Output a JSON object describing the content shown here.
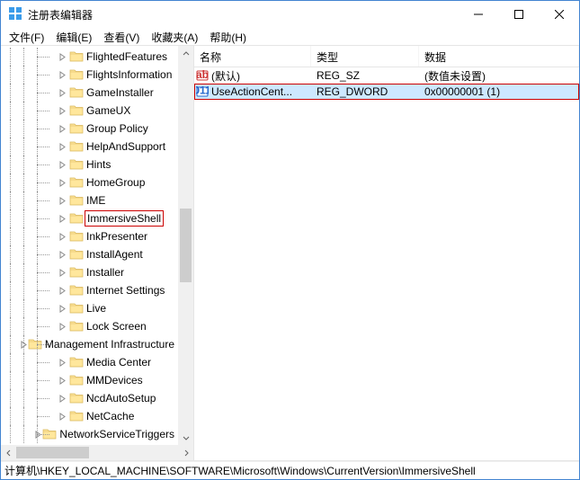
{
  "window": {
    "title": "注册表编辑器"
  },
  "menus": {
    "file": "文件(F)",
    "edit": "编辑(E)",
    "view": "查看(V)",
    "fav": "收藏夹(A)",
    "help": "帮助(H)"
  },
  "tree": {
    "items": [
      {
        "label": "FlightedFeatures",
        "selectedFlag": false
      },
      {
        "label": "FlightsInformation",
        "selectedFlag": false
      },
      {
        "label": "GameInstaller",
        "selectedFlag": false
      },
      {
        "label": "GameUX",
        "selectedFlag": false
      },
      {
        "label": "Group Policy",
        "selectedFlag": false
      },
      {
        "label": "HelpAndSupport",
        "selectedFlag": false
      },
      {
        "label": "Hints",
        "selectedFlag": false
      },
      {
        "label": "HomeGroup",
        "selectedFlag": false
      },
      {
        "label": "IME",
        "selectedFlag": false
      },
      {
        "label": "ImmersiveShell",
        "selectedFlag": true
      },
      {
        "label": "InkPresenter",
        "selectedFlag": false
      },
      {
        "label": "InstallAgent",
        "selectedFlag": false
      },
      {
        "label": "Installer",
        "selectedFlag": false
      },
      {
        "label": "Internet Settings",
        "selectedFlag": false
      },
      {
        "label": "Live",
        "selectedFlag": false
      },
      {
        "label": "Lock Screen",
        "selectedFlag": false
      },
      {
        "label": "Management Infrastructure",
        "selectedFlag": false
      },
      {
        "label": "Media Center",
        "selectedFlag": false
      },
      {
        "label": "MMDevices",
        "selectedFlag": false
      },
      {
        "label": "NcdAutoSetup",
        "selectedFlag": false
      },
      {
        "label": "NetCache",
        "selectedFlag": false
      },
      {
        "label": "NetworkServiceTriggers",
        "selectedFlag": false
      }
    ]
  },
  "list": {
    "headers": {
      "name": "名称",
      "type": "类型",
      "data": "数据"
    },
    "rows": [
      {
        "name": "(默认)",
        "type": "REG_SZ",
        "data": "(数值未设置)",
        "iconKind": "string",
        "selected": false
      },
      {
        "name": "UseActionCent...",
        "type": "REG_DWORD",
        "data": "0x00000001 (1)",
        "iconKind": "dword",
        "selected": true
      }
    ]
  },
  "status": {
    "path": "计算机\\HKEY_LOCAL_MACHINE\\SOFTWARE\\Microsoft\\Windows\\CurrentVersion\\ImmersiveShell"
  }
}
